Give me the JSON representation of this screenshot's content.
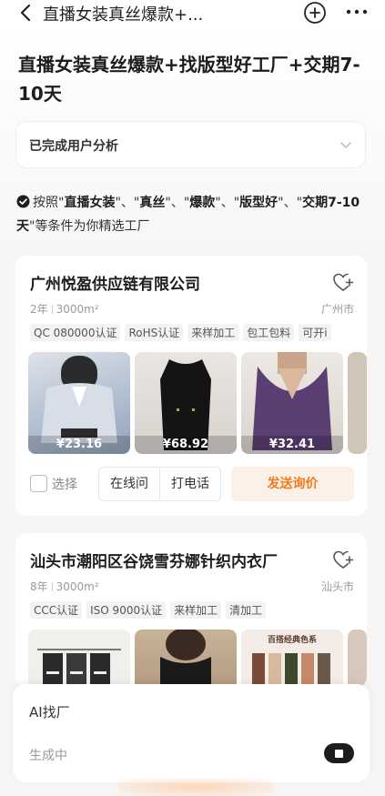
{
  "nav": {
    "title": "直播女装真丝爆款+...",
    "back_icon": "back-arrow-icon",
    "add_icon": "add-circle-icon",
    "more_icon": "more-dots-icon"
  },
  "query": {
    "title": "直播女装真丝爆款+找版型好工厂+交期7-10天"
  },
  "analysis": {
    "label": "已完成用户分析",
    "icon": "chevron-down-icon"
  },
  "criteria": {
    "prefix": "按照",
    "terms": [
      "直播女装",
      "真丝",
      "爆款",
      "版型好",
      "交期7-10天"
    ],
    "separator": "、",
    "suffix": "等条件为你精选工厂"
  },
  "factories": [
    {
      "name": "广州悦盈供应链有限公司",
      "years": "2年",
      "area": "3000m²",
      "city": "广州市",
      "tags": [
        "QC 080000认证",
        "RoHS认证",
        "来样加工",
        "包工包料",
        "可开i"
      ],
      "products": [
        {
          "price": "¥23.16",
          "desc": "blue-white shirt"
        },
        {
          "price": "¥68.92",
          "desc": "black velvet dress"
        },
        {
          "price": "¥32.41",
          "desc": "purple knit top"
        },
        {
          "price": "",
          "desc": "partial item"
        }
      ],
      "actions": {
        "select": "选择",
        "online": "在线问",
        "call": "打电话",
        "inquiry": "发送询价"
      }
    },
    {
      "name": "汕头市潮阳区谷饶雪芬娜针织内衣厂",
      "years": "8年",
      "area": "3000m²",
      "city": "汕头市",
      "tags": [
        "CCC认证",
        "ISO 9000认证",
        "来样加工",
        "清加工"
      ],
      "products": [
        {
          "price": "",
          "desc": "tops on hangers"
        },
        {
          "price": "",
          "desc": "black camisole"
        },
        {
          "price": "",
          "desc": "百搭经典色系"
        },
        {
          "price": "",
          "desc": "partial item"
        }
      ]
    }
  ],
  "panel": {
    "title": "AI找厂",
    "status": "生成中",
    "stop_icon": "stop-icon"
  },
  "colors": {
    "accent": "#f07a1f",
    "accent_bg": "#fdf0e6",
    "text_dark": "#1d1d1d",
    "muted": "#999999"
  }
}
